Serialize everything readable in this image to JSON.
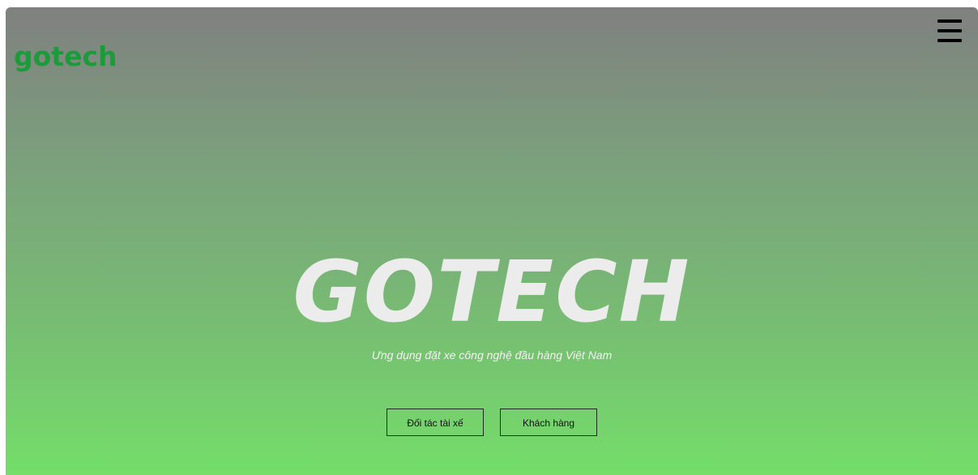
{
  "header": {
    "logo_text": "gotech",
    "logo_color": "#1c9b3a",
    "menu_icon": "hamburger-menu-icon"
  },
  "hero": {
    "title": "GOTECH",
    "subtitle": "Ưng dụng đặt xe công nghệ đầu hàng Việt Nam",
    "buttons": {
      "driver_partner": "Đối tác tài xế",
      "customer": "Khách hàng"
    }
  },
  "colors": {
    "gradient_top": "#808080",
    "gradient_bottom": "#74de69",
    "title_color": "#ececec"
  }
}
